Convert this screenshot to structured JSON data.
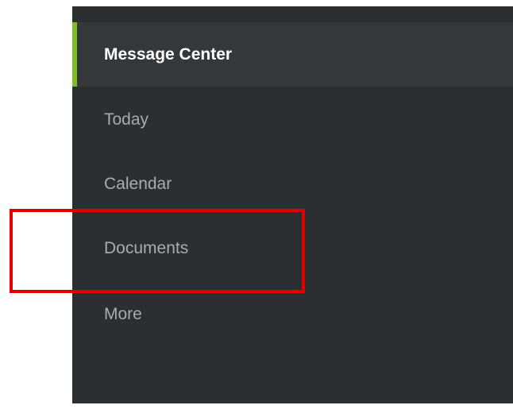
{
  "sidebar": {
    "items": [
      {
        "label": "Message Center",
        "active": true
      },
      {
        "label": "Today",
        "active": false
      },
      {
        "label": "Calendar",
        "active": false
      },
      {
        "label": "Documents",
        "active": false
      },
      {
        "label": "More",
        "active": false
      }
    ]
  },
  "colors": {
    "sidebar_bg": "#2b2f32",
    "active_bg": "#34383b",
    "active_indicator": "#7dbd2a",
    "active_text": "#ffffff",
    "inactive_text": "#a9abac",
    "annotation": "#e10000"
  },
  "annotation": {
    "target": "Documents"
  }
}
